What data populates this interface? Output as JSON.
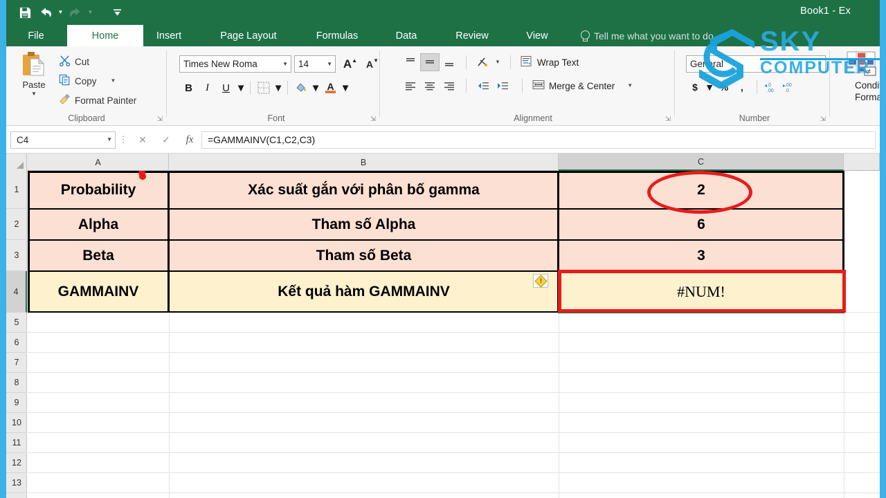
{
  "window": {
    "title": "Book1 - Ex",
    "theme_color": "#1e7145",
    "frame_color": "#3bb3e8"
  },
  "quick_access": [
    {
      "name": "save-icon",
      "label": "Save"
    },
    {
      "name": "undo-icon",
      "label": "Undo"
    },
    {
      "name": "redo-icon",
      "label": "Redo"
    },
    {
      "name": "customize-qat-icon",
      "label": "Customize Quick Access Toolbar"
    }
  ],
  "tabs": [
    {
      "label": "File",
      "active": false
    },
    {
      "label": "Home",
      "active": true
    },
    {
      "label": "Insert",
      "active": false
    },
    {
      "label": "Page Layout",
      "active": false
    },
    {
      "label": "Formulas",
      "active": false
    },
    {
      "label": "Data",
      "active": false
    },
    {
      "label": "Review",
      "active": false
    },
    {
      "label": "View",
      "active": false
    }
  ],
  "tell_me": {
    "placeholder": "Tell me what you want to do...",
    "visible_text": "Tell me what you wa"
  },
  "ribbon": {
    "clipboard": {
      "label": "Clipboard",
      "paste": "Paste",
      "cut": "Cut",
      "copy": "Copy",
      "format_painter": "Format Painter"
    },
    "font": {
      "label": "Font",
      "font_name": "Times New Roma",
      "font_size": "14",
      "bold": "B",
      "italic": "I",
      "underline": "U",
      "grow_font": "A",
      "shrink_font": "A"
    },
    "alignment": {
      "label": "Alignment",
      "wrap_text": "Wrap Text",
      "merge_center": "Merge & Center"
    },
    "number": {
      "label": "Number",
      "format": "General",
      "currency": "$",
      "percent": "%",
      "comma": ","
    },
    "styles": {
      "conditional_formatting_line1": "Conditio",
      "conditional_formatting_line2": "Formatti"
    }
  },
  "formula_bar": {
    "name_box": "C4",
    "formula": "=GAMMAINV(C1,C2,C3)",
    "cancel": "✕",
    "enter": "✓",
    "insert_function": "fx"
  },
  "sheet": {
    "columns": [
      {
        "label": "A",
        "selected": false
      },
      {
        "label": "B",
        "selected": false
      },
      {
        "label": "C",
        "selected": true
      }
    ],
    "rows": [
      {
        "label": "1",
        "selected": false
      },
      {
        "label": "2",
        "selected": false
      },
      {
        "label": "3",
        "selected": false
      },
      {
        "label": "4",
        "selected": true
      },
      {
        "label": "5",
        "selected": false
      },
      {
        "label": "6",
        "selected": false
      },
      {
        "label": "7",
        "selected": false
      },
      {
        "label": "8",
        "selected": false
      },
      {
        "label": "9",
        "selected": false
      },
      {
        "label": "10",
        "selected": false
      },
      {
        "label": "11",
        "selected": false
      },
      {
        "label": "12",
        "selected": false
      },
      {
        "label": "13",
        "selected": false
      }
    ],
    "data": [
      {
        "a": "Probability",
        "b": "Xác suất gắn với phân bố gamma",
        "c": "2"
      },
      {
        "a": "Alpha",
        "b": "Tham số Alpha",
        "c": "6"
      },
      {
        "a": "Beta",
        "b": "Tham số Beta",
        "c": "3"
      },
      {
        "a": "GAMMAINV",
        "b": "Kết quả hàm GAMMAINV",
        "c": "#NUM!"
      }
    ],
    "fill_peach": "#fbe0d3",
    "fill_cream": "#fdf2cd",
    "error_tag": {
      "name": "error-indicator-icon",
      "glyph": "!"
    },
    "selected_cell": "C4"
  },
  "annotations": {
    "ellipse_target": "C1",
    "rectangle_target": "C4",
    "color": "#e81c1c"
  },
  "watermark": {
    "line1": "SKY",
    "line2": "COMPUTER",
    "color": "#2aa9e0"
  }
}
